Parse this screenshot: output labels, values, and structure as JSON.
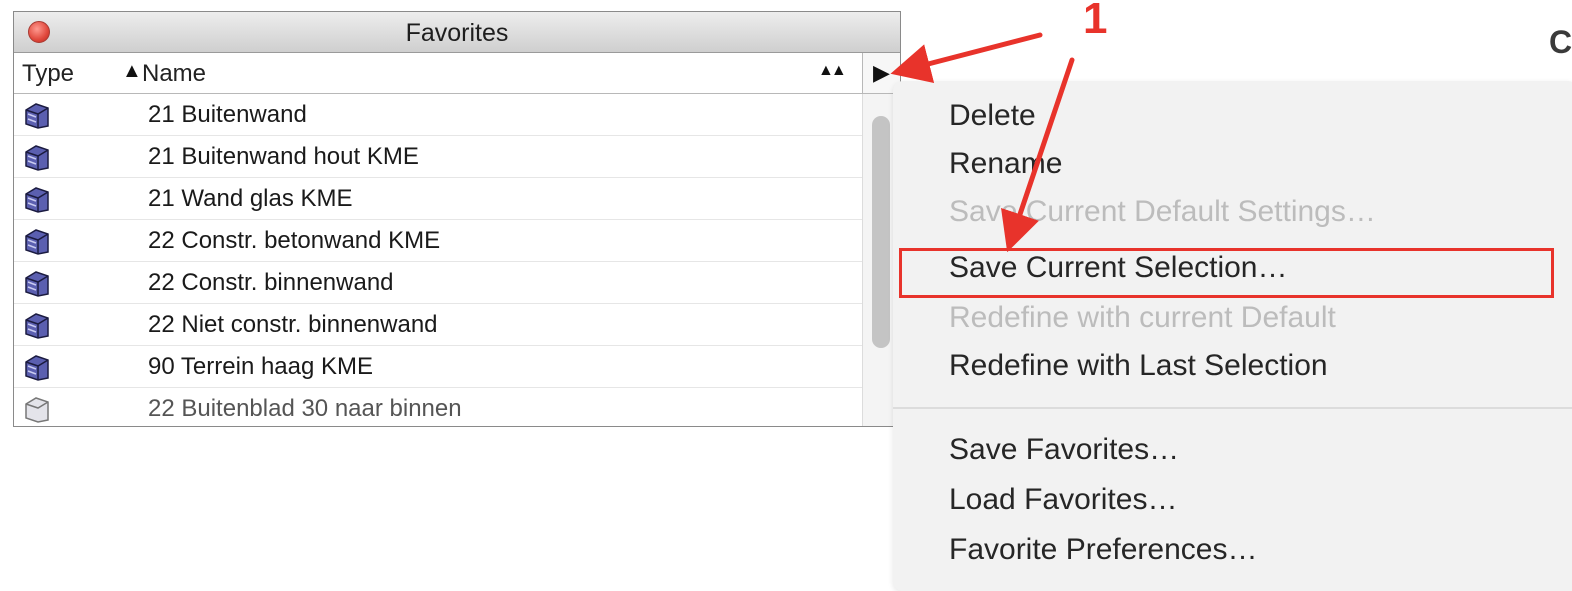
{
  "window": {
    "title": "Favorites",
    "header": {
      "type_label": "Type",
      "name_label": "Name",
      "sort_indicator": "▲",
      "sort_indicator_2": "▲▲",
      "menu_button": "▶"
    },
    "rows": [
      {
        "label": "21 Buitenwand"
      },
      {
        "label": "21 Buitenwand hout KME"
      },
      {
        "label": "21 Wand glas KME"
      },
      {
        "label": "22 Constr. betonwand KME"
      },
      {
        "label": "22 Constr. binnenwand"
      },
      {
        "label": "22 Niet constr. binnenwand"
      },
      {
        "label": "90 Terrein haag KME"
      },
      {
        "label": "22 Buitenblad 30 naar binnen"
      }
    ]
  },
  "menu": {
    "items": [
      {
        "label": "Delete",
        "enabled": true
      },
      {
        "label": "Rename",
        "enabled": true
      },
      {
        "label": "Save Current Default Settings…",
        "enabled": false
      },
      {
        "label": "Save Current Selection…",
        "enabled": true
      },
      {
        "label": "Redefine with current Default",
        "enabled": false
      },
      {
        "label": "Redefine with Last Selection",
        "enabled": true
      }
    ],
    "items2": [
      {
        "label": "Save Favorites…"
      },
      {
        "label": "Load Favorites…"
      },
      {
        "label": "Favorite Preferences…"
      }
    ]
  },
  "annotation": {
    "step": "1",
    "corner_text": "C",
    "color": "#e8332b"
  }
}
